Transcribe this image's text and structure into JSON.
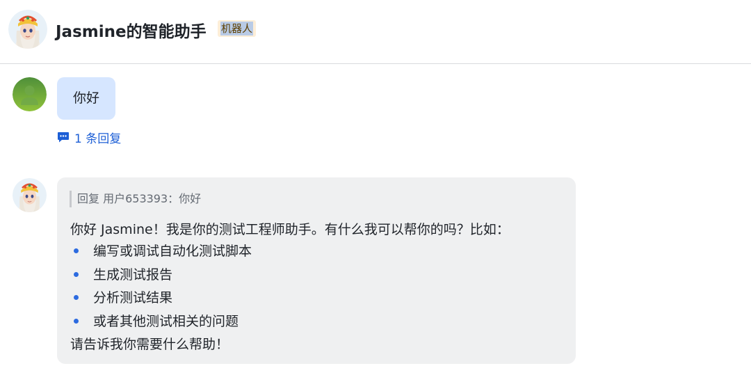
{
  "header": {
    "title": "Jasmine的智能助手",
    "bot_tag": "机器人"
  },
  "user_message": {
    "text": "你好",
    "reply_count_label": "1 条回复"
  },
  "bot_message": {
    "quote": "回复 用户653393：你好",
    "intro": "你好 Jasmine！我是你的测试工程师助手。有什么我可以帮你的吗？比如：",
    "items": [
      "编写或调试自动化测试脚本",
      "生成测试报告",
      "分析测试结果",
      "或者其他测试相关的问题"
    ],
    "outro": "请告诉我你需要什么帮助！"
  },
  "colors": {
    "accent": "#1d5fd6",
    "user_bubble": "#d6e6ff",
    "bot_bubble": "#eff0f1",
    "bot_tag_bg": "#fdeed8"
  },
  "icons": {
    "header_avatar": "cartoon-girl-avatar",
    "user_avatar": "default-user-avatar",
    "reply": "comment-bubble-icon"
  }
}
